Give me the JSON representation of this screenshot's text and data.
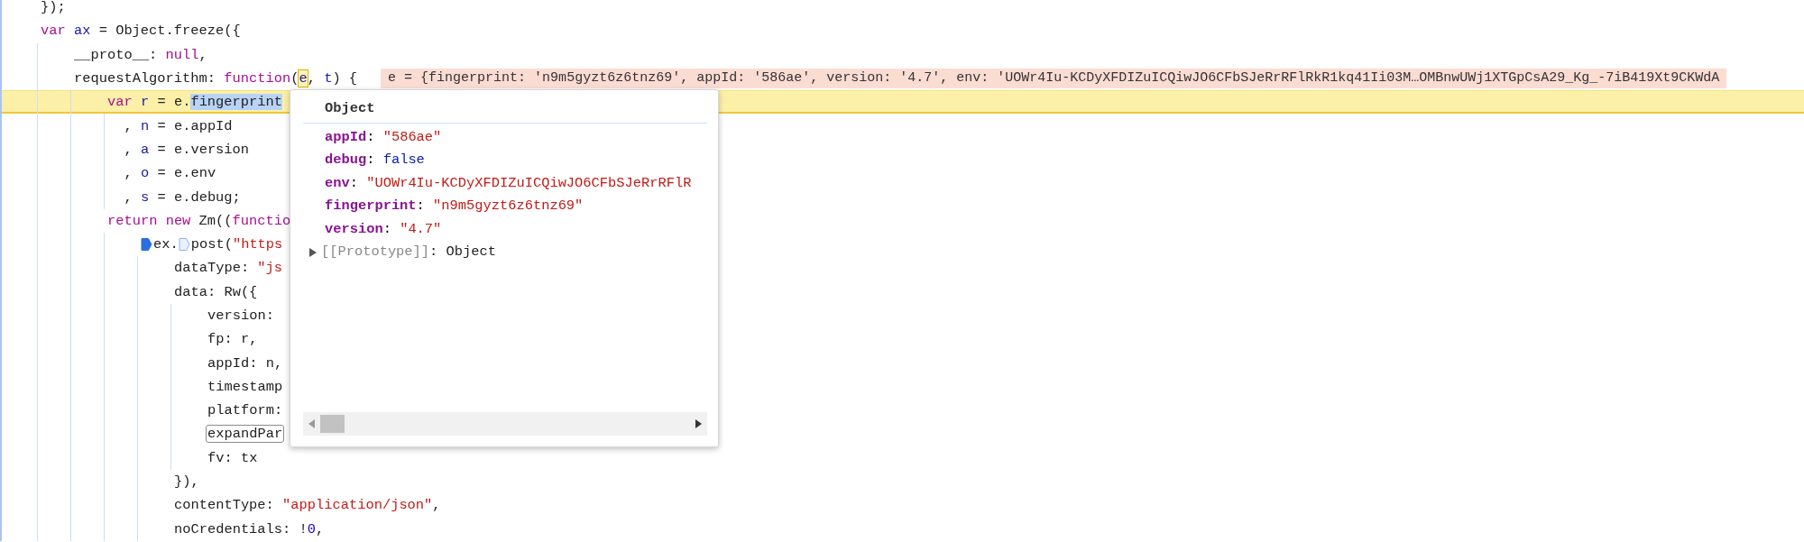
{
  "editor": {
    "lines": [
      {
        "current": false,
        "tokens": [
          {
            "text": "    });",
            "kind": "plain"
          }
        ]
      },
      {
        "current": false,
        "tokens": [
          {
            "text": "    var ",
            "kind": "keyword"
          },
          {
            "text": "ax",
            "kind": "definition"
          },
          {
            "text": " = Object.freeze({",
            "kind": "plain"
          }
        ]
      },
      {
        "current": false,
        "tokens": [
          {
            "text": "        __proto__: ",
            "kind": "plain"
          },
          {
            "text": "null",
            "kind": "keyword"
          },
          {
            "text": ",",
            "kind": "plain"
          }
        ]
      },
      {
        "current": false,
        "tokens": [
          {
            "text": "        requestAlgorithm: ",
            "kind": "plain"
          },
          {
            "text": "function",
            "kind": "keyword"
          },
          {
            "text": "(",
            "kind": "plain"
          },
          {
            "text": "e",
            "kind": "hovered"
          },
          {
            "text": ", ",
            "kind": "plain"
          },
          {
            "text": "t",
            "kind": "definition"
          },
          {
            "text": ") {",
            "kind": "plain"
          }
        ],
        "inline_value": "e = {fingerprint: 'n9m5gyzt6z6tnz69', appId: '586ae', version: '4.7', env: 'UOWr4Iu-KCDyXFDIZuICQiwJO6CFbSJeRrRFlRkR1kq41Ii03M…OMBnwUWj1XTGpCsA29_Kg_-7iB419Xt9CKWdA"
      },
      {
        "current": true,
        "tokens": [
          {
            "text": "            var ",
            "kind": "keyword"
          },
          {
            "text": "r",
            "kind": "definition"
          },
          {
            "text": " = e.",
            "kind": "plain"
          },
          {
            "text": "fingerprint",
            "kind": "selection"
          }
        ]
      },
      {
        "current": false,
        "tokens": [
          {
            "text": "              , ",
            "kind": "plain"
          },
          {
            "text": "n",
            "kind": "definition"
          },
          {
            "text": " = e.appId",
            "kind": "plain"
          }
        ]
      },
      {
        "current": false,
        "tokens": [
          {
            "text": "              , ",
            "kind": "plain"
          },
          {
            "text": "a",
            "kind": "definition"
          },
          {
            "text": " = e.version",
            "kind": "plain"
          }
        ]
      },
      {
        "current": false,
        "tokens": [
          {
            "text": "              , ",
            "kind": "plain"
          },
          {
            "text": "o",
            "kind": "definition"
          },
          {
            "text": " = e.env",
            "kind": "plain"
          }
        ]
      },
      {
        "current": false,
        "tokens": [
          {
            "text": "              , ",
            "kind": "plain"
          },
          {
            "text": "s",
            "kind": "definition"
          },
          {
            "text": " = e.debug;",
            "kind": "plain"
          }
        ]
      },
      {
        "current": false,
        "tokens": [
          {
            "text": "            return new",
            "kind": "keyword"
          },
          {
            "text": " Zm((",
            "kind": "plain"
          },
          {
            "text": "functio",
            "kind": "keyword"
          }
        ]
      },
      {
        "current": false,
        "tokens": [
          {
            "text": "                ex.",
            "kind": "plain",
            "breakpoint": {
              "enabled": true
            }
          },
          {
            "text": "post(",
            "kind": "plain",
            "breakpoint": {
              "enabled": false
            }
          },
          {
            "text": "\"https",
            "kind": "string"
          }
        ]
      },
      {
        "current": false,
        "tokens": [
          {
            "text": "                    dataType: ",
            "kind": "plain"
          },
          {
            "text": "\"js",
            "kind": "string"
          }
        ]
      },
      {
        "current": false,
        "tokens": [
          {
            "text": "                    data: Rw({",
            "kind": "plain"
          }
        ]
      },
      {
        "current": false,
        "tokens": [
          {
            "text": "                        version:",
            "kind": "plain"
          }
        ]
      },
      {
        "current": false,
        "tokens": [
          {
            "text": "                        fp: r,",
            "kind": "plain"
          }
        ]
      },
      {
        "current": false,
        "tokens": [
          {
            "text": "                        appId: n,",
            "kind": "plain"
          }
        ]
      },
      {
        "current": false,
        "tokens": [
          {
            "text": "                        timestamp",
            "kind": "plain"
          }
        ]
      },
      {
        "current": false,
        "tokens": [
          {
            "text": "                        platform:",
            "kind": "plain"
          }
        ]
      },
      {
        "current": false,
        "tokens": [
          {
            "text": "                        expandPar",
            "kind": "match"
          }
        ]
      },
      {
        "current": false,
        "tokens": [
          {
            "text": "                        fv: tx",
            "kind": "plain"
          }
        ]
      },
      {
        "current": false,
        "tokens": [
          {
            "text": "                    }),",
            "kind": "plain"
          }
        ]
      },
      {
        "current": false,
        "tokens": [
          {
            "text": "                    contentType: ",
            "kind": "plain"
          },
          {
            "text": "\"application/json\"",
            "kind": "string"
          },
          {
            "text": ",",
            "kind": "plain"
          }
        ]
      },
      {
        "current": false,
        "tokens": [
          {
            "text": "                    noCredentials: !",
            "kind": "plain"
          },
          {
            "text": "0",
            "kind": "number"
          },
          {
            "text": ",",
            "kind": "plain"
          }
        ]
      }
    ]
  },
  "popover": {
    "title": "Object",
    "properties": [
      {
        "key": "appId",
        "separator": ":",
        "value": "\"586ae\"",
        "kind": "string"
      },
      {
        "key": "debug",
        "separator": ":",
        "value": "false",
        "kind": "boolean"
      },
      {
        "key": "env",
        "separator": ":",
        "value": "\"UOWr4Iu-KCDyXFDIZuICQiwJO6CFbSJeRrRFlR",
        "kind": "string"
      },
      {
        "key": "fingerprint",
        "separator": ":",
        "value": "\"n9m5gyzt6z6tnz69\"",
        "kind": "string"
      },
      {
        "key": "version",
        "separator": ":",
        "value": "\"4.7\"",
        "kind": "string"
      }
    ],
    "prototype": {
      "label": "[[Prototype]]",
      "separator": ":",
      "value": "Object",
      "expanded": false
    }
  }
}
